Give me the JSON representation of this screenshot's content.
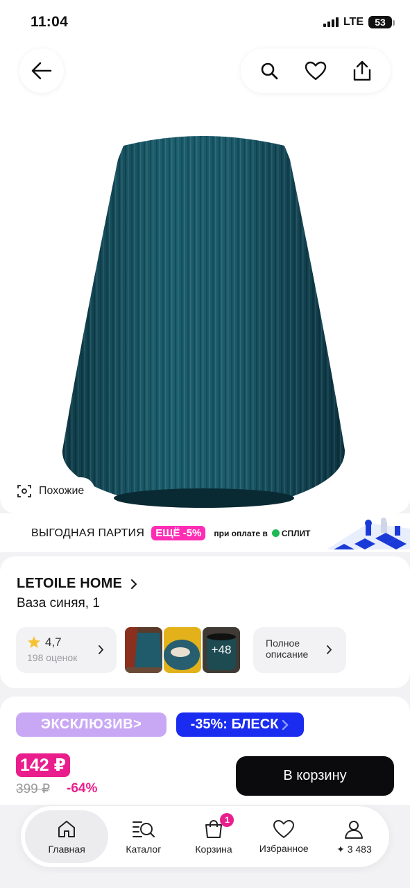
{
  "status_bar": {
    "time": "11:04",
    "network": "LTE",
    "battery": "53"
  },
  "hero": {
    "similar_label": "Похожие"
  },
  "promo": {
    "text": "ВЫГОДНАЯ ПАРТИЯ",
    "badge": "ЕЩЁ -5%",
    "pay_text": "при оплате в",
    "split": "СПЛИТ",
    "accent_color": "#ff2db4"
  },
  "product": {
    "brand": "LETOILE HOME",
    "name": "Ваза синяя, 1",
    "rating": "4,7",
    "reviews": "198 оценок",
    "more_photos": "+48",
    "description_label_1": "Полное",
    "description_label_2": "описание"
  },
  "badges": {
    "exclusive": "ЭКСКЛЮЗИВ>",
    "sale": "-35%: БЛЕСК"
  },
  "price": {
    "current": "142 ₽",
    "old": "399 ₽",
    "discount": "-64%",
    "brand_color": "#e91e8c"
  },
  "cart_button": "В корзину",
  "tabbar": {
    "items": [
      {
        "label": "Главная",
        "icon": "home-icon"
      },
      {
        "label": "Каталог",
        "icon": "catalog-icon"
      },
      {
        "label": "Корзина",
        "icon": "cart-icon",
        "badge": "1"
      },
      {
        "label": "Избранное",
        "icon": "heart-icon"
      },
      {
        "label": "✦ 3 483",
        "icon": "profile-icon"
      }
    ]
  }
}
